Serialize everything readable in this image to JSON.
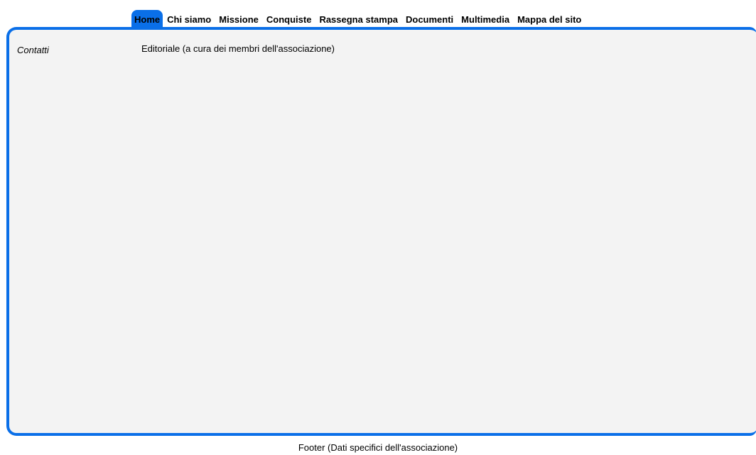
{
  "nav": {
    "items": [
      {
        "label": "Home",
        "active": true
      },
      {
        "label": "Chi siamo",
        "active": false
      },
      {
        "label": "Missione",
        "active": false
      },
      {
        "label": "Conquiste",
        "active": false
      },
      {
        "label": "Rassegna stampa",
        "active": false
      },
      {
        "label": "Documenti",
        "active": false
      },
      {
        "label": "Multimedia",
        "active": false
      },
      {
        "label": "Mappa del sito",
        "active": false
      }
    ]
  },
  "sidebar": {
    "contact_link": "Contatti"
  },
  "main": {
    "editorial_text": "Editoriale (a cura dei membri dell'associazione)"
  },
  "footer": {
    "text": "Footer (Dati specifici dell'associazione)"
  },
  "colors": {
    "accent": "#0a6fe8",
    "panel_background": "#f3f3f3"
  }
}
